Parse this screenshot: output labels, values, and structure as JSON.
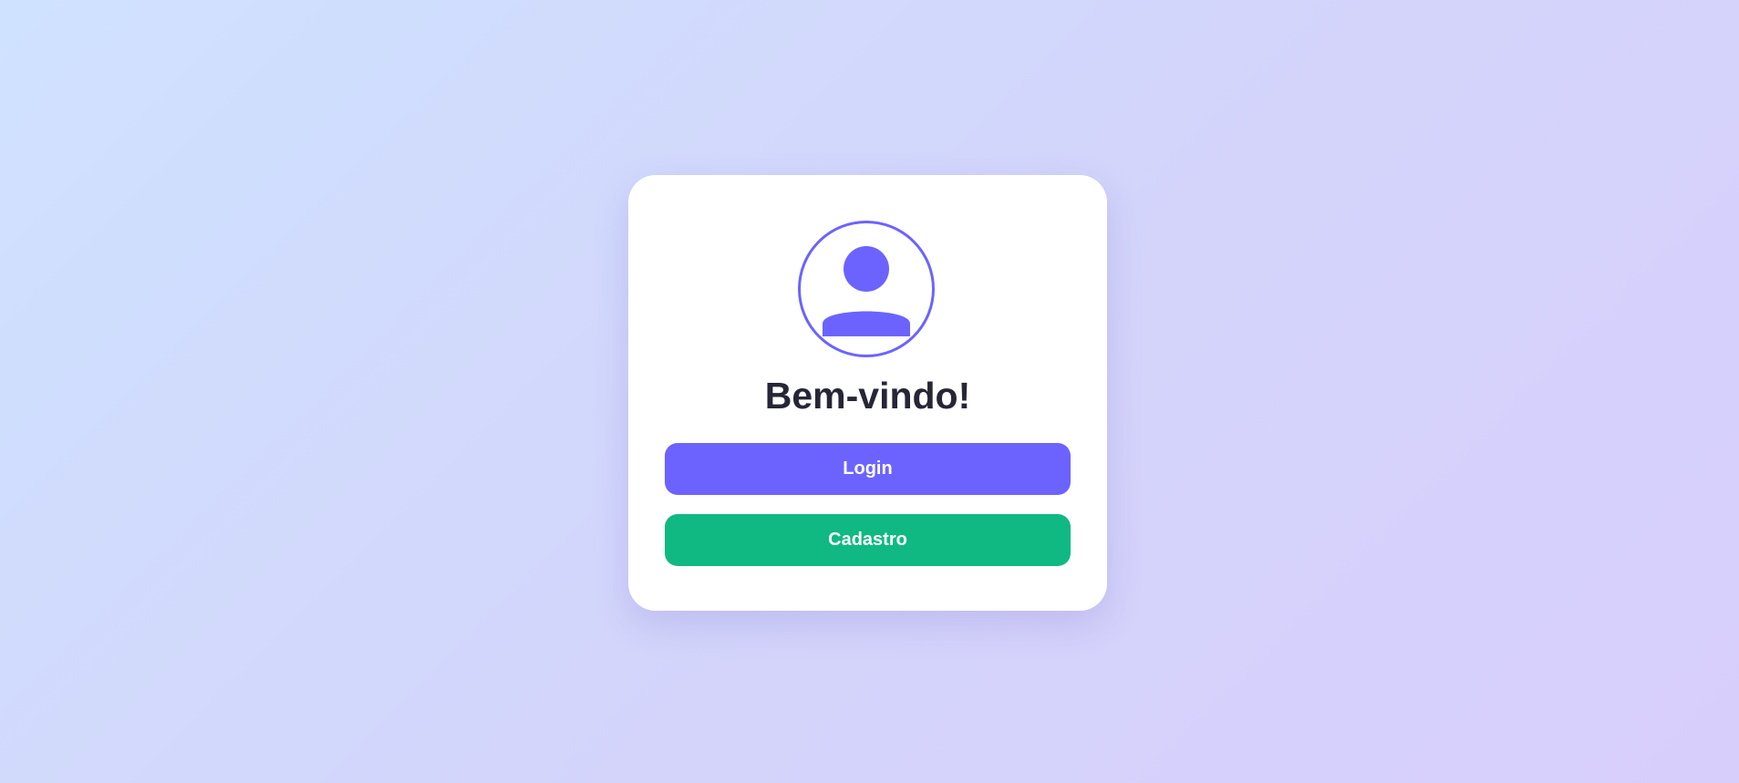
{
  "page": {
    "background_colors": [
      "#cfe2ff",
      "#d8cefc"
    ]
  },
  "card": {
    "avatar_icon": "user-icon",
    "title": "Bem-vindo!",
    "buttons": {
      "login_label": "Login",
      "register_label": "Cadastro"
    }
  },
  "colors": {
    "accent": "#6c63ff",
    "success": "#10b981",
    "title_text": "#262637",
    "card_bg": "#ffffff"
  }
}
